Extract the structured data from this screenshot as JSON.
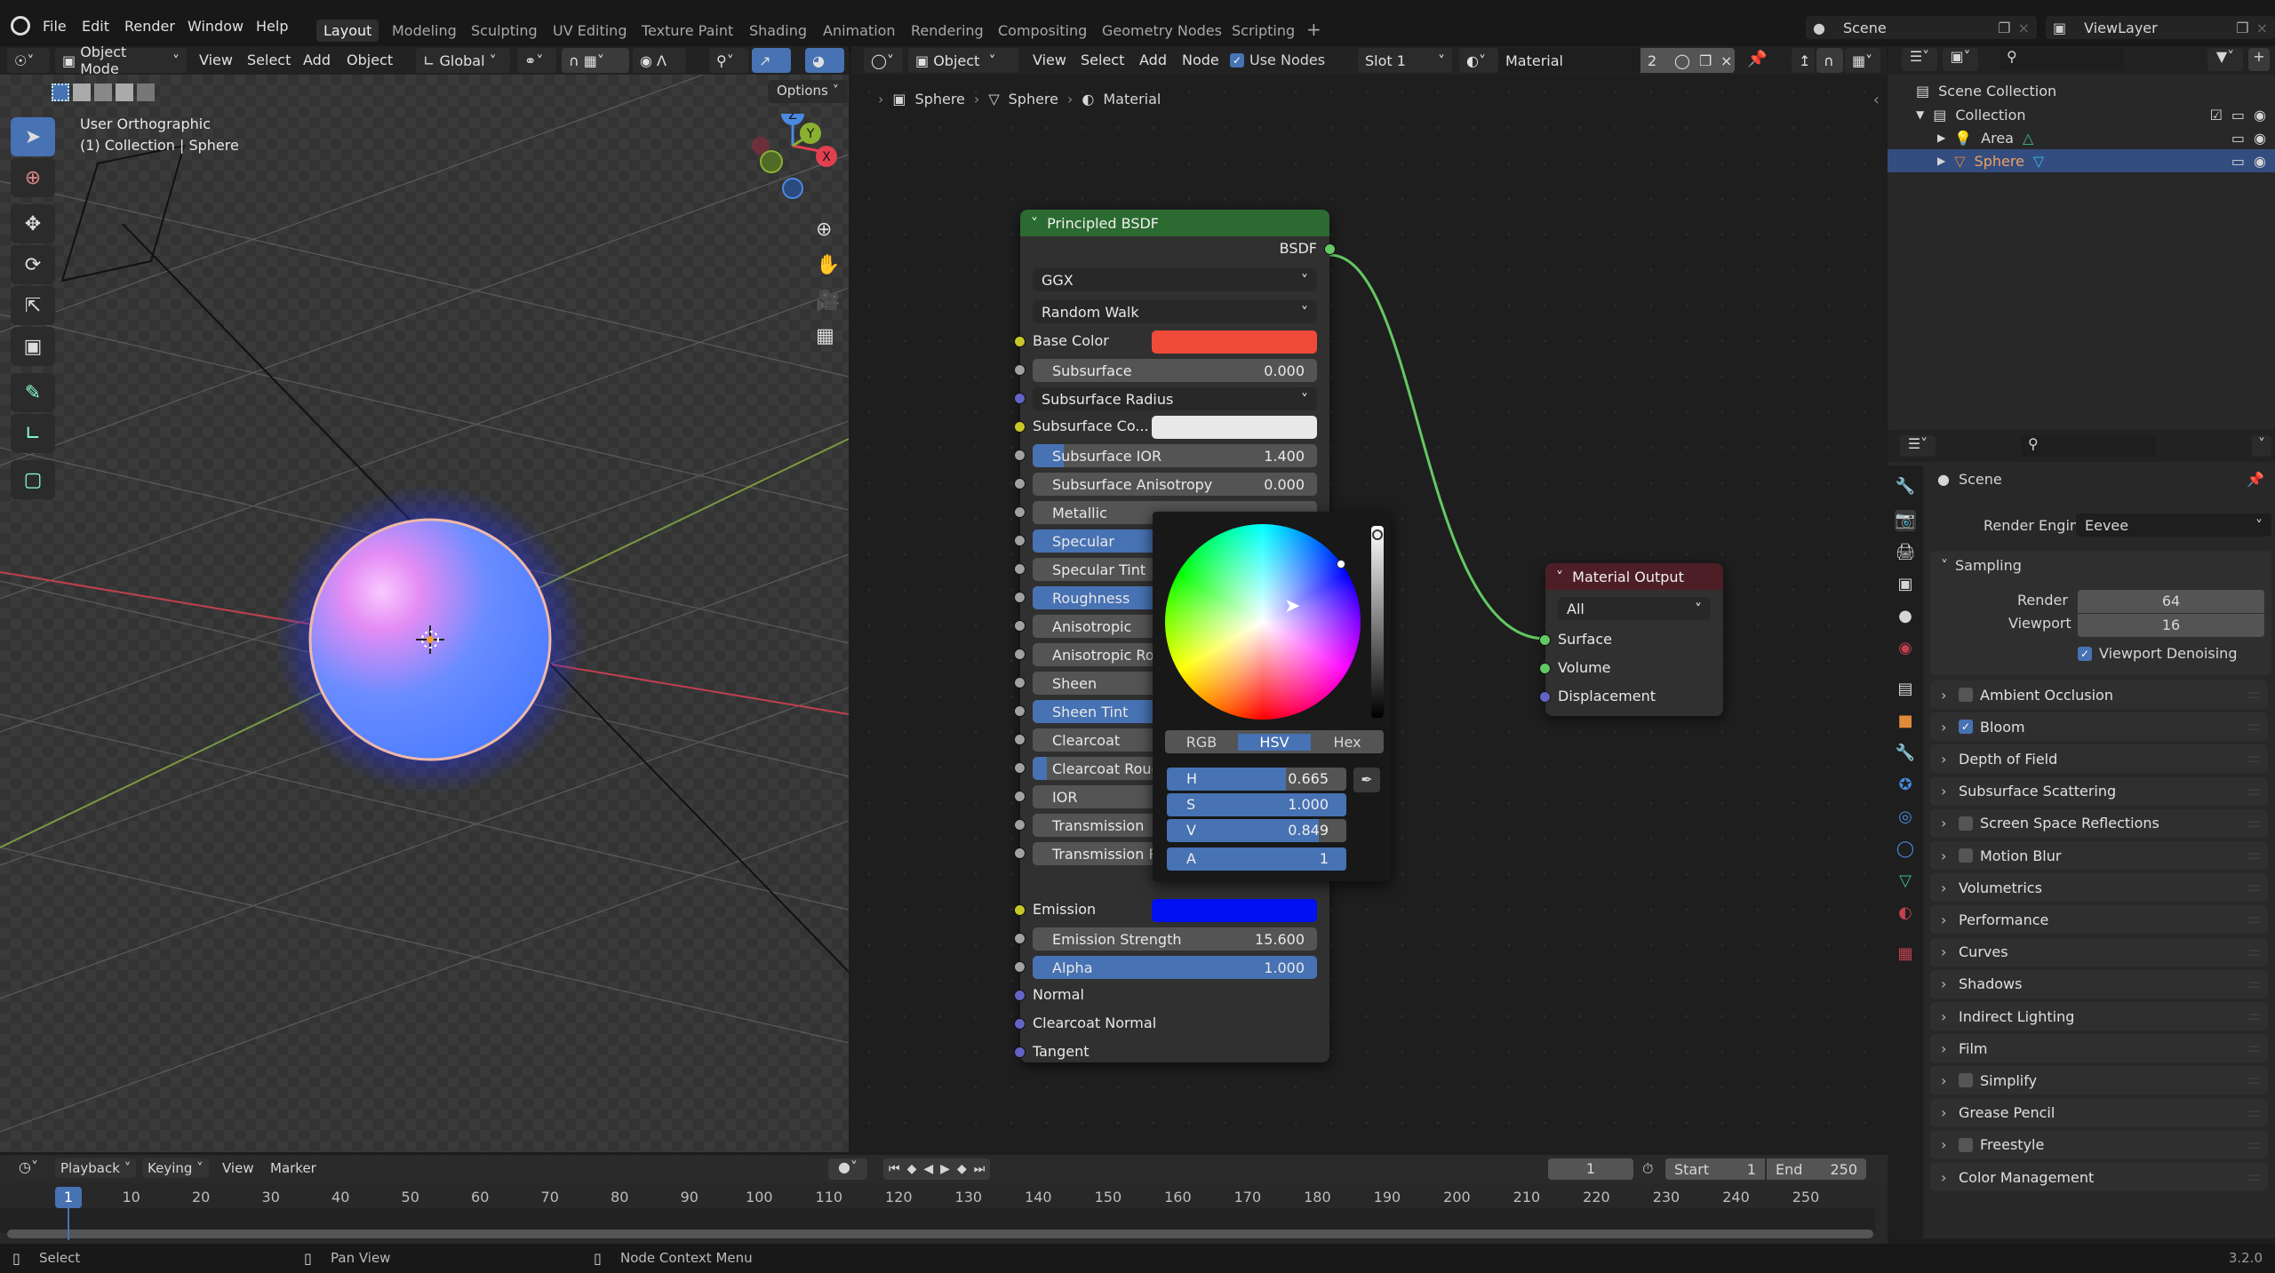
{
  "app": {
    "version": "3.2.0"
  },
  "menu": [
    "File",
    "Edit",
    "Render",
    "Window",
    "Help"
  ],
  "workspaces": {
    "active": "Layout",
    "tabs": [
      "Layout",
      "Modeling",
      "Sculpting",
      "UV Editing",
      "Texture Paint",
      "Shading",
      "Animation",
      "Rendering",
      "Compositing",
      "Geometry Nodes",
      "Scripting"
    ]
  },
  "scene_selector": {
    "scene": "Scene",
    "view_layer": "ViewLayer"
  },
  "viewport": {
    "header": {
      "mode": "Object Mode",
      "menus": [
        "View",
        "Select",
        "Add",
        "Object"
      ],
      "orientation": "Global",
      "options_label": "Options"
    },
    "overlay_text": {
      "view_name": "User Orthographic",
      "context": "(1) Collection | Sphere"
    },
    "gizmo_axes": {
      "z": "Z",
      "y": "Y",
      "x": "X"
    },
    "tools": [
      "select-box",
      "cursor",
      "move",
      "rotate",
      "scale",
      "transform",
      "annotate",
      "measure",
      "add-cube"
    ]
  },
  "node_editor": {
    "header": {
      "object_mode": "Object",
      "menus": [
        "View",
        "Select",
        "Add",
        "Node"
      ],
      "use_nodes_label": "Use Nodes",
      "use_nodes": true,
      "slot": "Slot 1",
      "material": "Material",
      "users": "2"
    },
    "breadcrumb": [
      "Sphere",
      "Sphere",
      "Material"
    ],
    "principled": {
      "title": "Principled BSDF",
      "output": "BSDF",
      "distribution": "GGX",
      "subsurface_method": "Random Walk",
      "base_color_label": "Base Color",
      "base_color": "#f04a3a",
      "subsurface_color_label": "Subsurface Co...",
      "subsurface_color": "#e8e8e8",
      "subsurface_radius_label": "Subsurface Radius",
      "emission_label": "Emission",
      "emission_color": "#0010f0",
      "fields": [
        {
          "label": "Subsurface",
          "value": "0.000",
          "fill": 0
        },
        {
          "label": "Subsurface IOR",
          "value": "1.400",
          "fill": 0.11
        },
        {
          "label": "Subsurface Anisotropy",
          "value": "0.000",
          "fill": 0
        },
        {
          "label": "Metallic",
          "value": "",
          "fill": 0
        },
        {
          "label": "Specular",
          "value": "",
          "fill": 1
        },
        {
          "label": "Specular Tint",
          "value": "",
          "fill": 0
        },
        {
          "label": "Roughness",
          "value": "",
          "fill": 0.84
        },
        {
          "label": "Anisotropic",
          "value": "",
          "fill": 0
        },
        {
          "label": "Anisotropic Ro",
          "value": "",
          "fill": 0
        },
        {
          "label": "Sheen",
          "value": "",
          "fill": 0
        },
        {
          "label": "Sheen Tint",
          "value": "",
          "fill": 1
        },
        {
          "label": "Clearcoat",
          "value": "",
          "fill": 0
        },
        {
          "label": "Clearcoat Roug",
          "value": "",
          "fill": 0.05
        },
        {
          "label": "IOR",
          "value": "",
          "fill": 0
        },
        {
          "label": "Transmission",
          "value": "",
          "fill": 0
        },
        {
          "label": "Transmission R",
          "value": "",
          "fill": 0
        }
      ],
      "emission_strength": {
        "label": "Emission Strength",
        "value": "15.600"
      },
      "alpha": {
        "label": "Alpha",
        "value": "1.000"
      },
      "vector_inputs": [
        "Normal",
        "Clearcoat Normal",
        "Tangent"
      ]
    },
    "material_output": {
      "title": "Material Output",
      "target": "All",
      "inputs": [
        "Surface",
        "Volume",
        "Displacement"
      ]
    },
    "color_picker": {
      "modes": [
        "RGB",
        "HSV",
        "Hex"
      ],
      "active_mode": "HSV",
      "channels": [
        {
          "key": "H",
          "value": "0.665",
          "fill": 0.665
        },
        {
          "key": "S",
          "value": "1.000",
          "fill": 1.0
        },
        {
          "key": "V",
          "value": "0.849",
          "fill": 0.849
        },
        {
          "key": "A",
          "value": "1",
          "fill": 1.0
        }
      ]
    }
  },
  "outliner": {
    "root": "Scene Collection",
    "items": [
      {
        "name": "Collection",
        "level": 1
      },
      {
        "name": "Area",
        "level": 2
      },
      {
        "name": "Sphere",
        "level": 2,
        "selected": true
      }
    ]
  },
  "properties": {
    "context": "Scene",
    "render_engine_label": "Render Engine",
    "render_engine": "Eevee",
    "sampling": {
      "title": "Sampling",
      "render_label": "Render",
      "render": "64",
      "viewport_label": "Viewport",
      "viewport": "16",
      "denoise_label": "Viewport Denoising",
      "denoise": true
    },
    "panels": [
      {
        "label": "Ambient Occlusion",
        "checkbox": false
      },
      {
        "label": "Bloom",
        "checkbox": true
      },
      {
        "label": "Depth of Field"
      },
      {
        "label": "Subsurface Scattering"
      },
      {
        "label": "Screen Space Reflections",
        "checkbox": false
      },
      {
        "label": "Motion Blur",
        "checkbox": false
      },
      {
        "label": "Volumetrics"
      },
      {
        "label": "Performance"
      },
      {
        "label": "Curves"
      },
      {
        "label": "Shadows"
      },
      {
        "label": "Indirect Lighting"
      },
      {
        "label": "Film"
      },
      {
        "label": "Simplify",
        "checkbox": false
      },
      {
        "label": "Grease Pencil"
      },
      {
        "label": "Freestyle",
        "checkbox": false
      },
      {
        "label": "Color Management"
      }
    ]
  },
  "timeline": {
    "menus": [
      "Playback",
      "Keying",
      "View",
      "Marker"
    ],
    "current_frame": "1",
    "start_label": "Start",
    "start": "1",
    "end_label": "End",
    "end": "250",
    "ticks": [
      "10",
      "20",
      "30",
      "40",
      "50",
      "60",
      "70",
      "80",
      "90",
      "100",
      "110",
      "120",
      "130",
      "140",
      "150",
      "160",
      "170",
      "180",
      "190",
      "200",
      "210",
      "220",
      "230",
      "240",
      "250"
    ],
    "playhead": "1"
  },
  "statusbar": {
    "hints": [
      "Select",
      "Pan View",
      "Node Context Menu"
    ]
  }
}
